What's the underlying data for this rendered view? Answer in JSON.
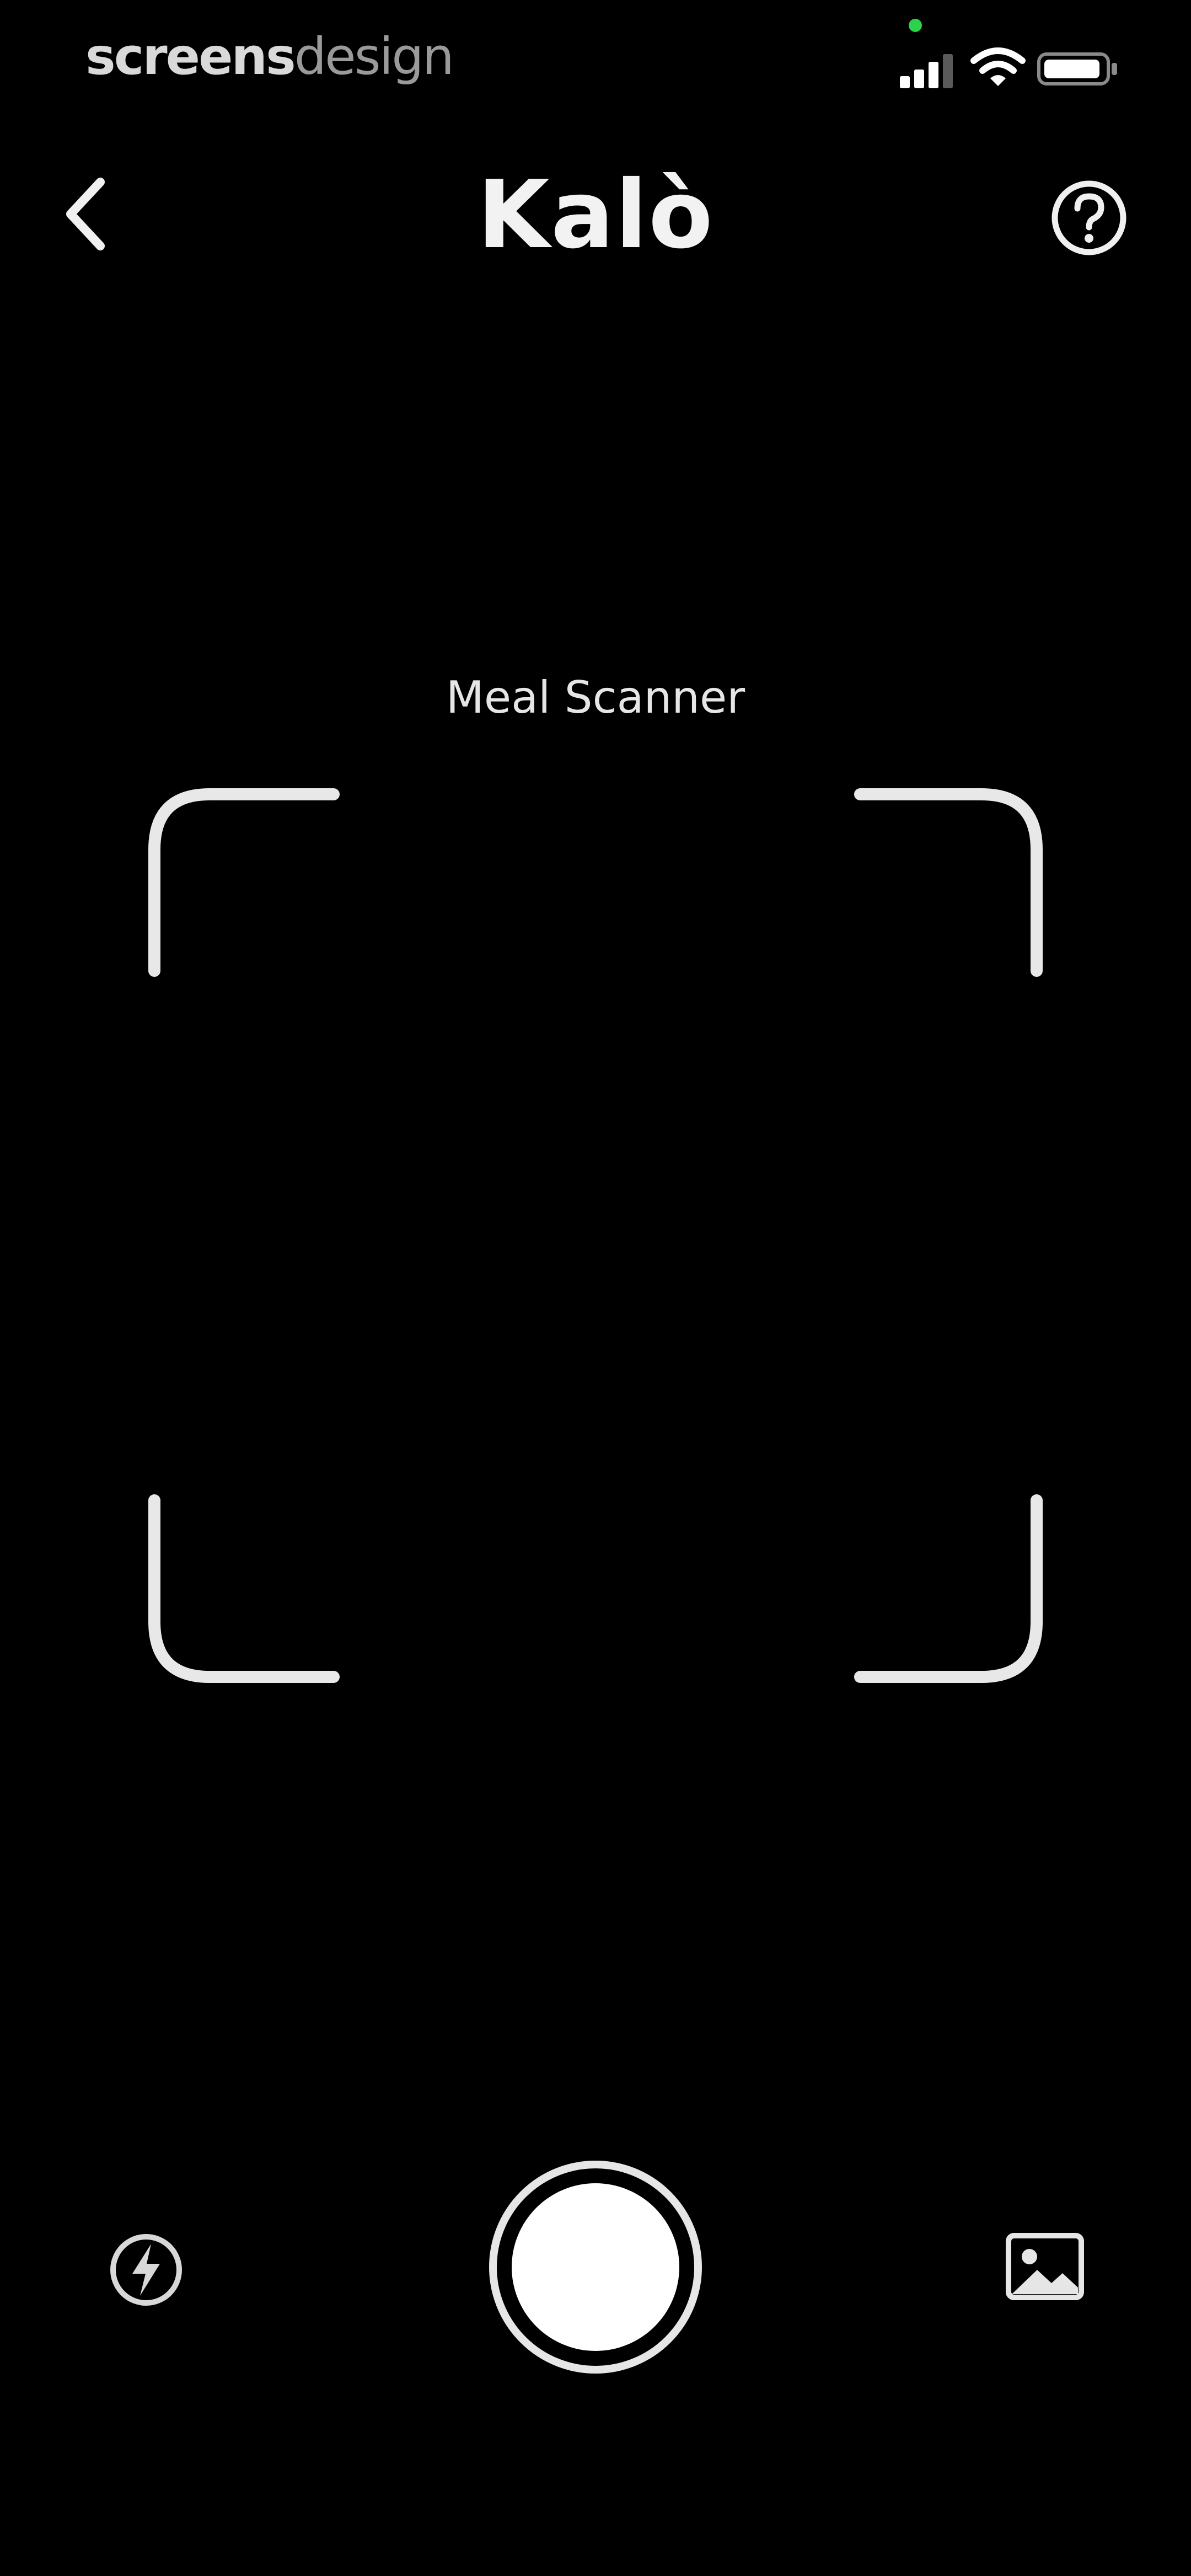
{
  "status_bar": {
    "watermark_bold": "screens",
    "watermark_light": "design",
    "icons": [
      "signal-icon",
      "wifi-icon",
      "battery-icon"
    ]
  },
  "nav": {
    "title": "Kalò",
    "back_icon": "chevron-left-icon",
    "help_icon": "question-circle-icon"
  },
  "scanner": {
    "label": "Meal Scanner"
  },
  "controls": {
    "flash_icon": "flash-icon",
    "shutter": "shutter-button",
    "gallery_icon": "photo-gallery-icon"
  },
  "colors": {
    "background": "#000000",
    "foreground": "#ffffff",
    "indicator": "#2bd24a"
  }
}
